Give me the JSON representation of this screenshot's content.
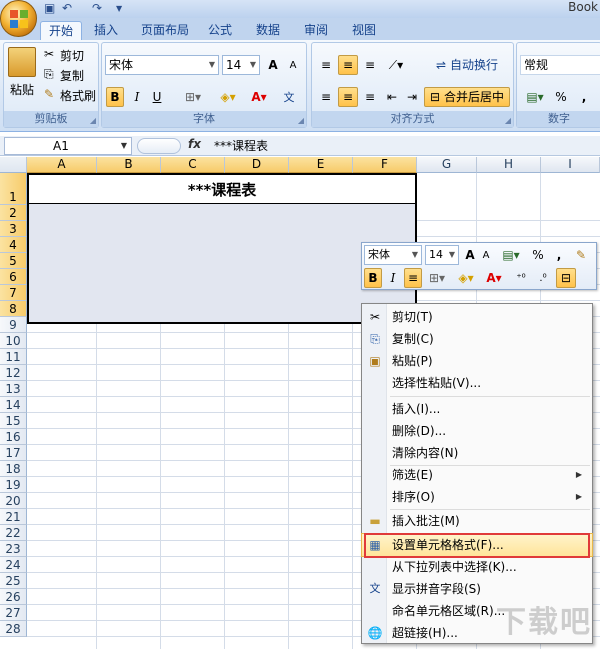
{
  "window": {
    "book_title": "Book"
  },
  "tabs": [
    "开始",
    "插入",
    "页面布局",
    "公式",
    "数据",
    "审阅",
    "视图"
  ],
  "clipboard": {
    "paste": "粘贴",
    "cut": "剪切",
    "copy": "复制",
    "format_painter": "格式刷",
    "group": "剪贴板"
  },
  "font": {
    "name": "宋体",
    "size": "14",
    "bold": "B",
    "italic": "I",
    "underline": "U",
    "grow": "A",
    "shrink": "A",
    "group": "字体"
  },
  "alignment": {
    "wrap": "自动换行",
    "merge": "合并后居中",
    "group": "对齐方式"
  },
  "number": {
    "format": "常规",
    "percent": "%",
    "comma": ",",
    "group": "数字"
  },
  "formula_bar": {
    "name_box": "A1",
    "fx": "fx",
    "value": "***课程表"
  },
  "columns": [
    "A",
    "B",
    "C",
    "D",
    "E",
    "F",
    "G",
    "H",
    "I"
  ],
  "rows": [
    "1",
    "2",
    "3",
    "4",
    "5",
    "6",
    "7",
    "8",
    "9",
    "10",
    "11",
    "12",
    "13",
    "14",
    "15",
    "16",
    "17",
    "18",
    "19",
    "20",
    "21",
    "22",
    "23",
    "24",
    "25",
    "26",
    "27",
    "28"
  ],
  "cell_title": "***课程表",
  "mini_toolbar": {
    "font": "宋体",
    "size": "14",
    "bold": "B",
    "italic": "I",
    "percent": "%",
    "comma": ","
  },
  "context_menu": [
    {
      "label": "剪切(T)",
      "icon": "scissors-icon"
    },
    {
      "label": "复制(C)",
      "icon": "copy-icon"
    },
    {
      "label": "粘贴(P)",
      "icon": "paste-icon"
    },
    {
      "label": "选择性粘贴(V)..."
    },
    {
      "label": "插入(I)..."
    },
    {
      "label": "删除(D)..."
    },
    {
      "label": "清除内容(N)"
    },
    {
      "label": "筛选(E)",
      "submenu": true
    },
    {
      "label": "排序(O)",
      "submenu": true
    },
    {
      "label": "插入批注(M)",
      "icon": "comment-icon"
    },
    {
      "label": "设置单元格格式(F)...",
      "icon": "format-cells-icon",
      "highlight": true
    },
    {
      "label": "从下拉列表中选择(K)..."
    },
    {
      "label": "显示拼音字段(S)",
      "icon": "pinyin-icon"
    },
    {
      "label": "命名单元格区域(R)..."
    },
    {
      "label": "超链接(H)...",
      "icon": "hyperlink-icon"
    }
  ],
  "watermark": "下载吧"
}
